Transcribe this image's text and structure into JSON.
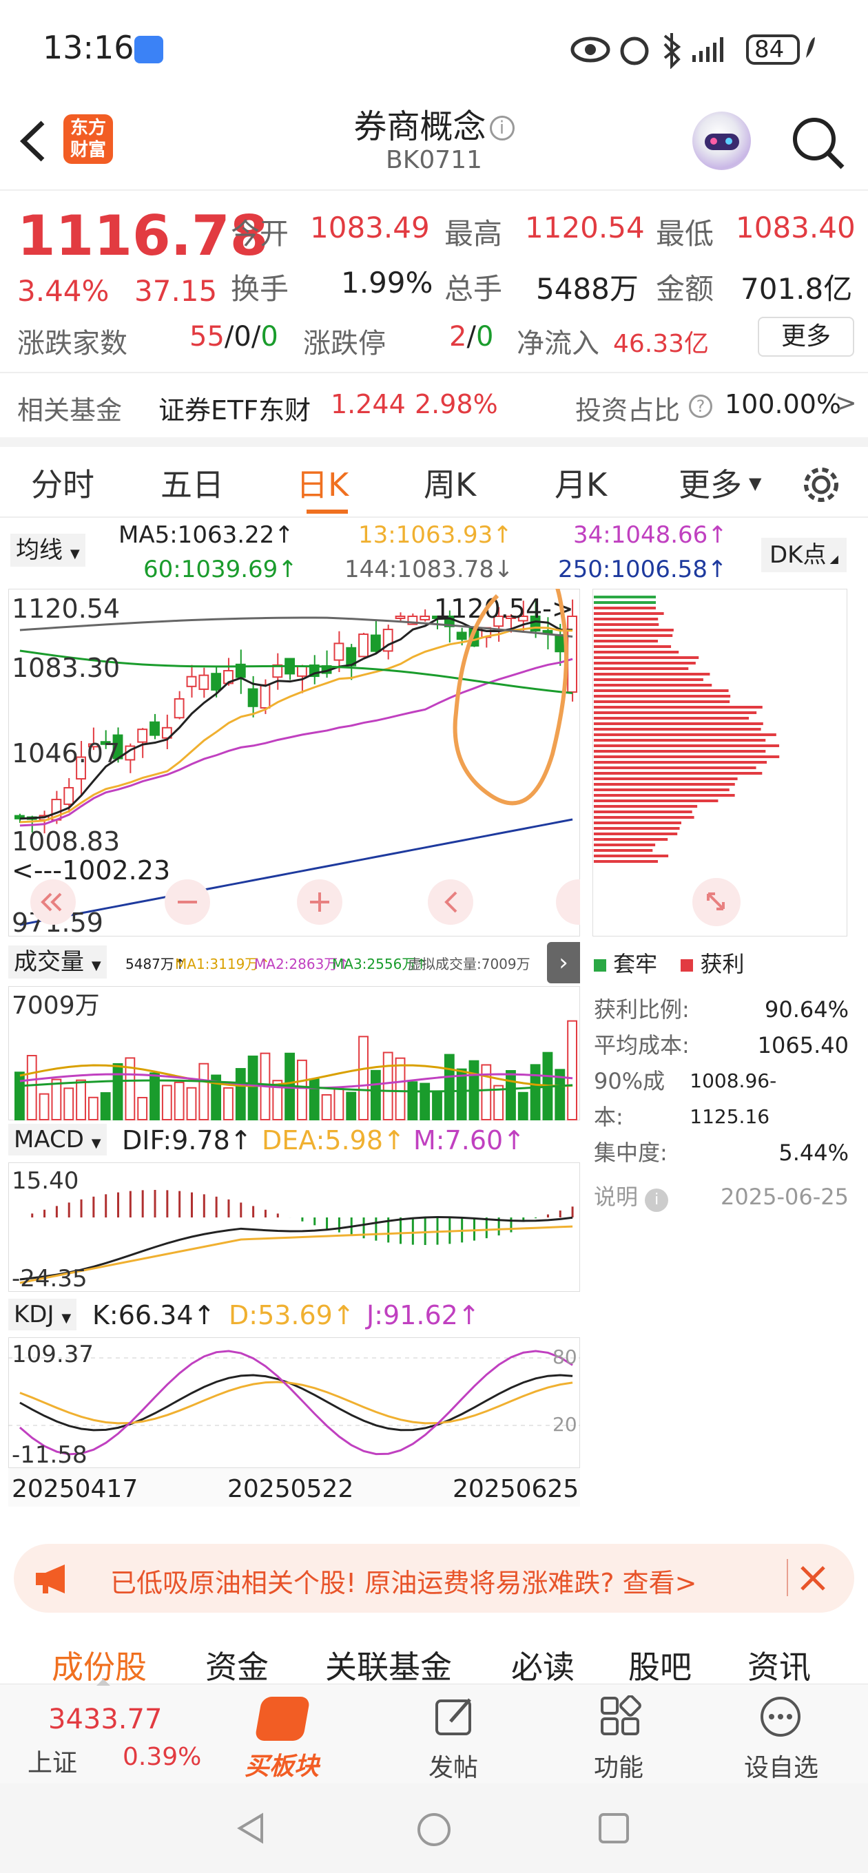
{
  "status": {
    "time": "13:16",
    "battery": "84"
  },
  "header": {
    "title": "券商概念",
    "code": "BK0711",
    "logo_top": "东方",
    "logo_bottom": "财富"
  },
  "quote": {
    "price": "1116.78",
    "pct": "3.44%",
    "chg": "37.15",
    "open_label": "今开",
    "open": "1083.49",
    "high_label": "最高",
    "high": "1120.54",
    "low_label": "最低",
    "low": "1083.40",
    "turn_label": "换手",
    "turn": "1.99%",
    "vol_label": "总手",
    "vol": "5488万",
    "amt_label": "金额",
    "amt": "701.8亿",
    "updown_label": "涨跌家数",
    "up": "55",
    "flat": "0",
    "down": "0",
    "limit_label": "涨跌停",
    "limit_up": "2",
    "limit_down": "0",
    "netflow_label": "净流入",
    "netflow": "46.33亿",
    "more": "更多"
  },
  "fund": {
    "label": "相关基金",
    "name": "证券ETF东财",
    "price": "1.244",
    "pct": "2.98%",
    "ratio_label": "投资占比",
    "ratio": "100.00%"
  },
  "tabs": [
    "分时",
    "五日",
    "日K",
    "周K",
    "月K",
    "更多"
  ],
  "ma": {
    "dropdown": "均线",
    "ma5": "MA5:1063.22↑",
    "ma13": "13:1063.93↑",
    "ma34": "34:1048.66↑",
    "ma60": "60:1039.69↑",
    "ma144": "144:1083.78↓",
    "ma250": "250:1006.58↑",
    "dk": "DK点"
  },
  "kline_labels": {
    "y1": "1120.54",
    "y2": "1083.30",
    "y3": "1046.07",
    "y4": "1008.83",
    "y5": "971.59",
    "high_note": "1120.54->",
    "low_note": "<---1002.23"
  },
  "volume": {
    "dropdown": "成交量",
    "text": "5487万↑",
    "ma1": "MA1:3119万↑",
    "ma2": "MA2:2863万↑",
    "ma3": "MA3:2556万↑",
    "virt": "虚拟成交量:7009万",
    "ymax": "7009万"
  },
  "macd": {
    "dropdown": "MACD",
    "dif": "DIF:9.78↑",
    "dea": "DEA:5.98↑",
    "m": "M:7.60↑",
    "ymax": "15.40",
    "ymin": "-24.35"
  },
  "kdj": {
    "dropdown": "KDJ",
    "k": "K:66.34↑",
    "d": "D:53.69↑",
    "j": "J:91.62↑",
    "ymax": "109.37",
    "ymin": "-11.58",
    "l80": "80",
    "l20": "20"
  },
  "dates": [
    "20250417",
    "20250522",
    "20250625"
  ],
  "chip": {
    "legend_hold": "套牢",
    "legend_profit": "获利",
    "profit_label": "获利比例:",
    "profit": "90.64%",
    "cost_label": "平均成本:",
    "cost": "1065.40",
    "range_label": "90%成本:",
    "range": "1008.96-1125.16",
    "conc_label": "集中度:",
    "conc": "5.44%",
    "note": "说明",
    "date": "2025-06-25"
  },
  "banner": {
    "text": "已低吸原油相关个股! 原油运费将易涨难跌? 查看>"
  },
  "subtabs": [
    "成份股",
    "资金",
    "关联基金",
    "必读",
    "股吧",
    "资讯"
  ],
  "bottom": {
    "index_value": "3433.77",
    "index_name": "上证",
    "index_pct": "0.39%",
    "buy": "买板块",
    "post": "发帖",
    "func": "功能",
    "watch": "设自选"
  }
}
